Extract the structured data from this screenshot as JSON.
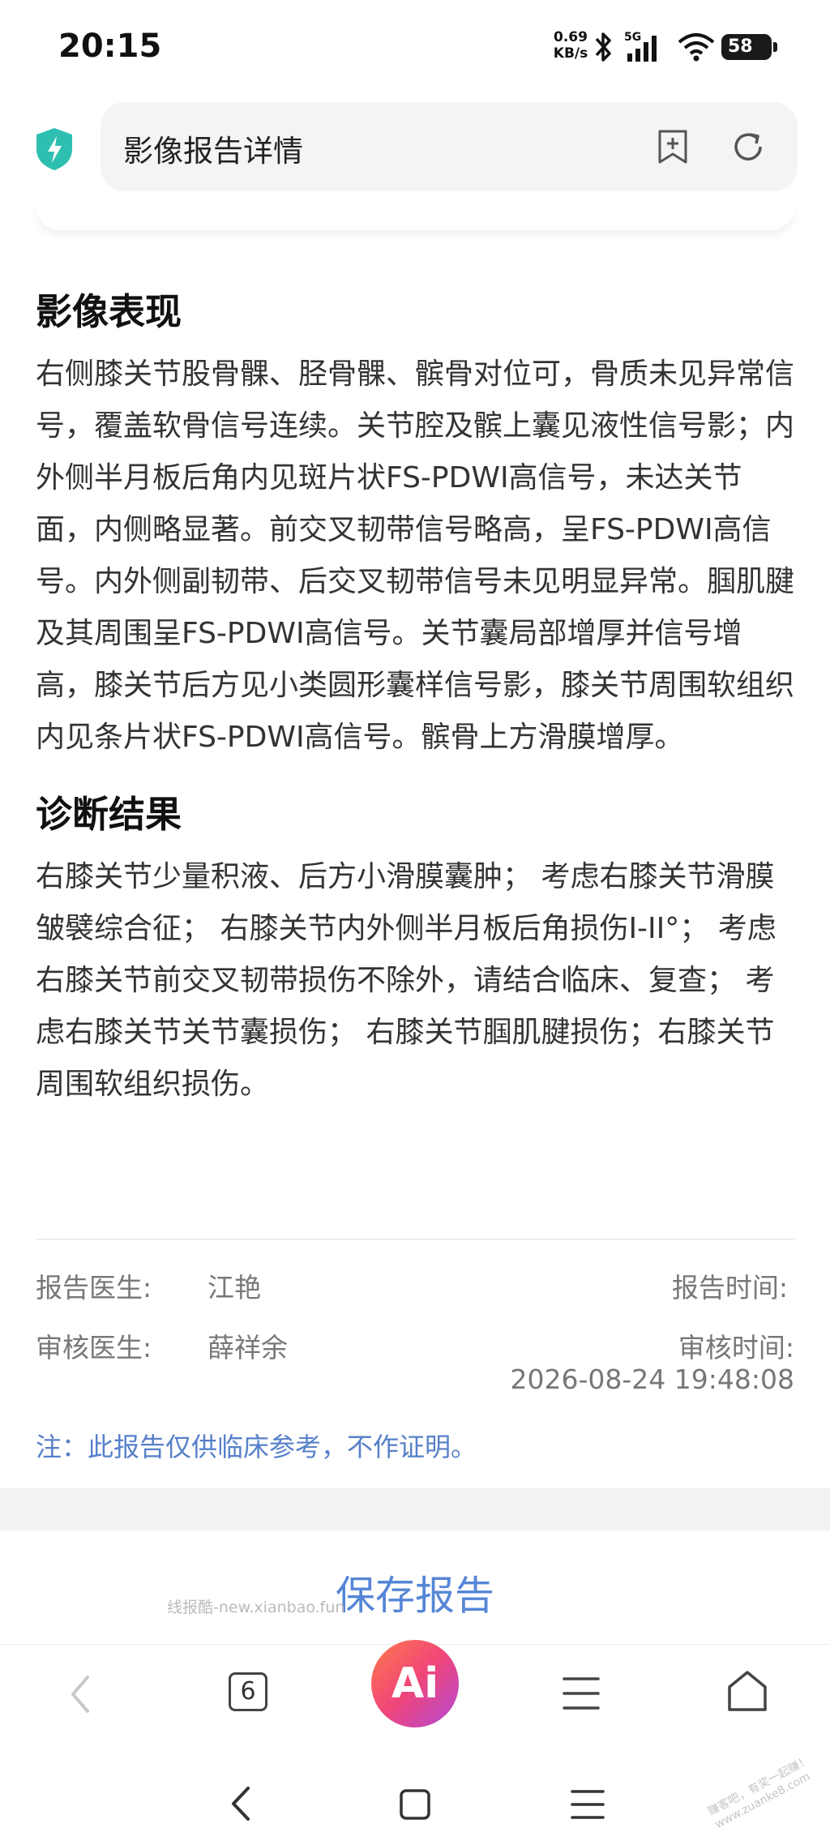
{
  "status_bar": {
    "time": "20:15",
    "net_speed_value": "0.69",
    "net_speed_unit": "KB/s",
    "network_type": "5G",
    "battery": "58"
  },
  "header": {
    "title": "影像报告详情",
    "icons": [
      "shield-bolt-icon",
      "bookmark-add-icon",
      "refresh-icon"
    ]
  },
  "findings": {
    "heading": "影像表现",
    "text": "右侧膝关节股骨髁、胫骨髁、髌骨对位可，骨质未见异常信号，覆盖软骨信号连续。关节腔及髌上囊见液性信号影；内外侧半月板后角内见斑片状FS-PDWI高信号，未达关节面，内侧略显著。前交叉韧带信号略高，呈FS-PDWI高信号。内外侧副韧带、后交叉韧带信号未见明显异常。腘肌腱及其周围呈FS-PDWI高信号。关节囊局部增厚并信号增高，膝关节后方见小类圆形囊样信号影，膝关节周围软组织内见条片状FS-PDWI高信号。髌骨上方滑膜增厚。"
  },
  "diagnosis": {
    "heading": "诊断结果",
    "text": "右膝关节少量积液、后方小滑膜囊肿； 考虑右膝关节滑膜皱襞综合征； 右膝关节内外侧半月板后角损伤I-II°； 考虑右膝关节前交叉韧带损伤不除外，请结合临床、复查； 考虑右膝关节关节囊损伤； 右膝关节腘肌腱损伤；右膝关节周围软组织损伤。"
  },
  "report_meta": {
    "report_doctor_label": "报告医生:",
    "report_doctor": "江艳",
    "report_time_label": "报告时间:",
    "review_doctor_label": "审核医生:",
    "review_doctor": "薛祥余",
    "review_time_label": "审核时间:",
    "review_time": "2026-08-24 19:48:08",
    "note": "注：此报告仅供临床参考，不作证明。"
  },
  "actions": {
    "save_label": "保存报告",
    "watermark": "线报酷-new.xianbao.fun"
  },
  "browser_bar": {
    "tab_count": "6",
    "ai_label": "Ai"
  },
  "corner_watermark": "赚客吧，有奖一起赚！ www.zuanke8.com",
  "colors": {
    "accent": "#5686d6",
    "note": "#5680c8",
    "shield": "#2fbfb0"
  }
}
